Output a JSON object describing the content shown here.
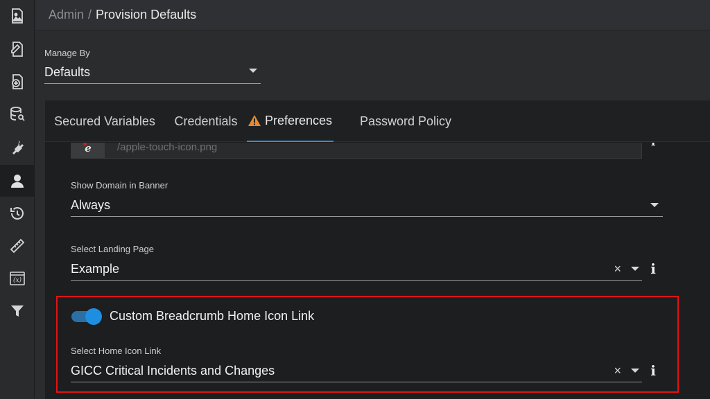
{
  "breadcrumb": {
    "parent": "Admin",
    "separator": "/",
    "current": "Provision Defaults"
  },
  "rail": {
    "items": [
      {
        "icon": "image-file-icon",
        "active": false
      },
      {
        "icon": "edit-file-icon",
        "active": false
      },
      {
        "icon": "add-file-icon",
        "active": false
      },
      {
        "icon": "database-search-icon",
        "active": false
      },
      {
        "icon": "plug-icon",
        "active": false
      },
      {
        "icon": "user-icon",
        "active": true
      },
      {
        "icon": "history-icon",
        "active": false
      },
      {
        "icon": "ruler-icon",
        "active": false
      },
      {
        "icon": "variable-icon",
        "active": false
      },
      {
        "icon": "filter-icon",
        "active": false
      }
    ]
  },
  "manage_by": {
    "label": "Manage By",
    "value": "Defaults"
  },
  "tabs": [
    {
      "label": "Secured Variables",
      "active": false
    },
    {
      "label": "Credentials",
      "active": false
    },
    {
      "label": "Preferences",
      "active": true,
      "icon": "warning-icon"
    },
    {
      "label": "Password Policy",
      "active": false
    }
  ],
  "image_field": {
    "thumb_letter": "e",
    "path": "/apple-touch-icon.png"
  },
  "show_domain": {
    "label": "Show Domain in Banner",
    "value": "Always"
  },
  "landing_page": {
    "label": "Select Landing Page",
    "value": "Example",
    "clear": "×",
    "info": "i"
  },
  "custom_breadcrumb": {
    "toggle_label": "Custom Breadcrumb Home Icon Link",
    "enabled": true
  },
  "home_icon_link": {
    "label": "Select Home Icon Link",
    "value": "GICC Critical Incidents and Changes",
    "clear": "×",
    "info": "i"
  },
  "colors": {
    "accent": "#2c93d9",
    "highlight": "#e01414",
    "warning": "#e8892b",
    "toggle": "#1e8fe0"
  }
}
